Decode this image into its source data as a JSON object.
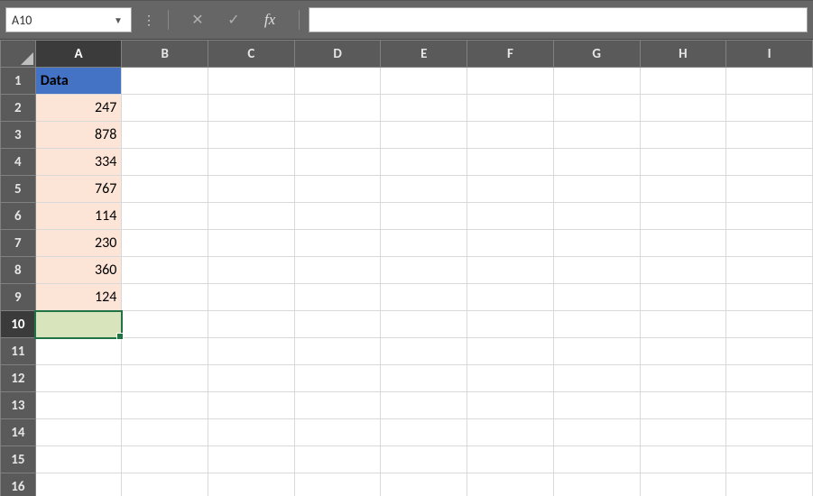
{
  "formula_bar": {
    "name_box_value": "A10",
    "formula_value": "",
    "cancel_symbol": "✕",
    "enter_symbol": "✓",
    "fx_label": "fx",
    "more_symbol": "⋮"
  },
  "columns": [
    "A",
    "B",
    "C",
    "D",
    "E",
    "F",
    "G",
    "H",
    "I"
  ],
  "row_count": 16,
  "active_cell": {
    "col": "A",
    "row": 10
  },
  "cells": {
    "A1": {
      "value": "Data",
      "align": "left",
      "style": "header-blue"
    },
    "A2": {
      "value": "247",
      "align": "right",
      "style": "peach"
    },
    "A3": {
      "value": "878",
      "align": "right",
      "style": "peach"
    },
    "A4": {
      "value": "334",
      "align": "right",
      "style": "peach"
    },
    "A5": {
      "value": "767",
      "align": "right",
      "style": "peach"
    },
    "A6": {
      "value": "114",
      "align": "right",
      "style": "peach"
    },
    "A7": {
      "value": "230",
      "align": "right",
      "style": "peach"
    },
    "A8": {
      "value": "360",
      "align": "right",
      "style": "peach"
    },
    "A9": {
      "value": "124",
      "align": "right",
      "style": "peach"
    },
    "A10": {
      "value": "",
      "align": "left",
      "style": "selected"
    }
  },
  "chart_data": {
    "type": "table",
    "title": "",
    "columns": [
      "Data"
    ],
    "rows": [
      [
        247
      ],
      [
        878
      ],
      [
        334
      ],
      [
        767
      ],
      [
        114
      ],
      [
        230
      ],
      [
        360
      ],
      [
        124
      ]
    ]
  }
}
